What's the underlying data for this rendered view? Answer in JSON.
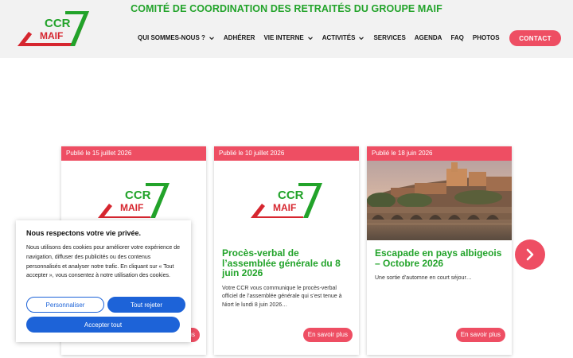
{
  "header": {
    "site_title": "COMITÉ DE COORDINATION DES RETRAITÉS DU GROUPE MAIF",
    "logo": {
      "line1": "CCR",
      "line2": "MAIF"
    },
    "nav": [
      {
        "label": "QUI SOMMES-NOUS ?",
        "has_dropdown": true
      },
      {
        "label": "ADHÉRER",
        "has_dropdown": false
      },
      {
        "label": "VIE INTERNE",
        "has_dropdown": true
      },
      {
        "label": "ACTIVITÉS",
        "has_dropdown": true
      },
      {
        "label": "SERVICES",
        "has_dropdown": false
      },
      {
        "label": "AGENDA",
        "has_dropdown": false
      },
      {
        "label": "FAQ",
        "has_dropdown": false
      },
      {
        "label": "PHOTOS",
        "has_dropdown": false
      }
    ],
    "contact_label": "CONTACT"
  },
  "cards": [
    {
      "date": "Publié le 15 juillet 2026",
      "title": "",
      "excerpt": "",
      "more_label": "En savoir plus"
    },
    {
      "date": "Publié le 10 juillet 2026",
      "title": "Procès-verbal de l’assemblée générale du 8 juin 2026",
      "excerpt": "Votre CCR vous communique le procès-verbal officiel de l’assemblée générale qui s’est tenue à Niort le lundi 8 juin 2026…",
      "more_label": "En savoir plus"
    },
    {
      "date": "Publié le 18 juin 2026",
      "title": "Escapade en pays albigeois – Octobre 2026",
      "excerpt": "Une sortie d’automne en court séjour…",
      "more_label": "En savoir plus"
    }
  ],
  "cookie": {
    "title": "Nous respectons votre vie privée.",
    "text": "Nous utilisons des cookies pour améliorer votre expérience de navigation, diffuser des publicités ou des contenus personnalisés et analyser notre trafic. En cliquant sur « Tout accepter », vous consentez à notre utilisation des cookies.",
    "customize_label": "Personnaliser",
    "reject_label": "Tout rejeter",
    "accept_label": "Accepter tout"
  },
  "colors": {
    "brand_green": "#22a32a",
    "brand_red": "#ee4e63",
    "cookie_blue": "#1d63d8"
  },
  "icons": [
    "chevron-down-icon",
    "chevron-right-icon",
    "ccr-maif-logo"
  ]
}
